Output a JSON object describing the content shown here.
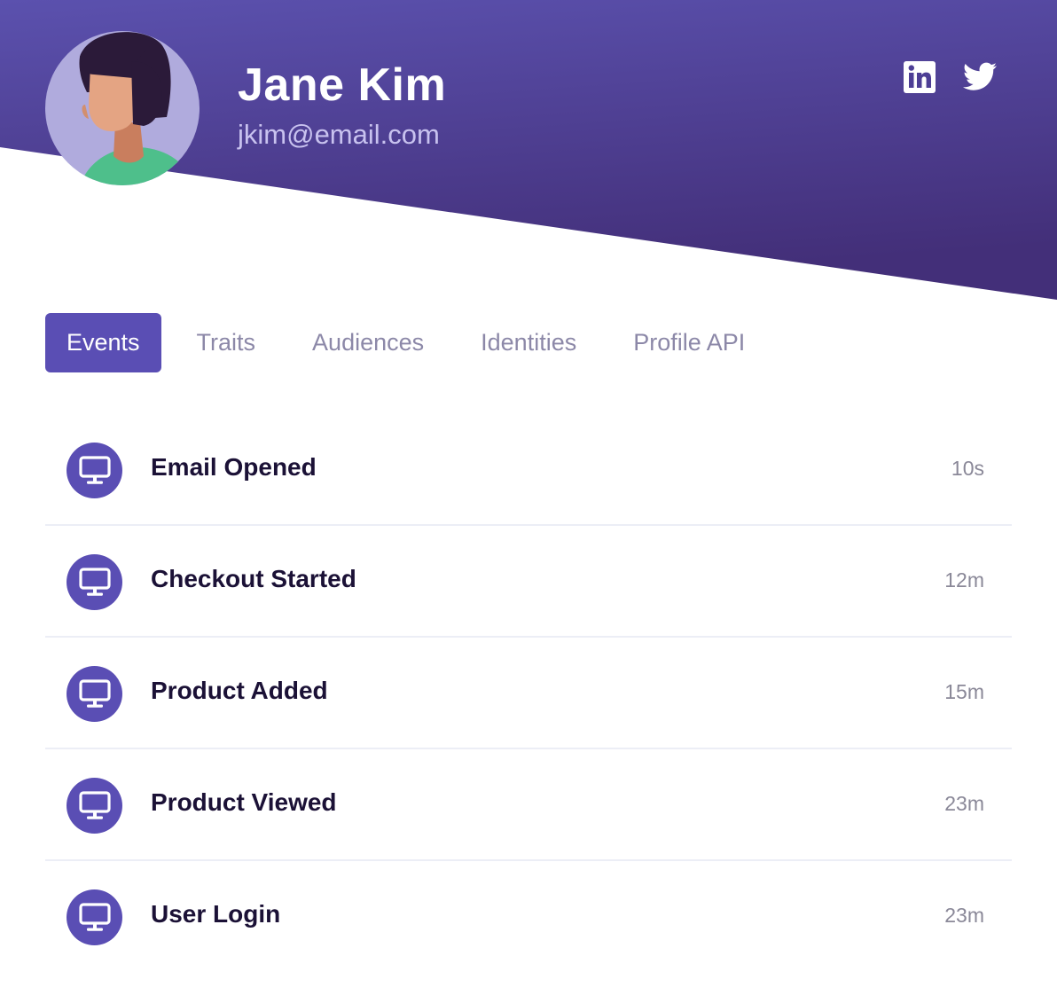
{
  "profile": {
    "name": "Jane Kim",
    "email": "jkim@email.com",
    "avatar_icon": "user-avatar-illustration",
    "social": [
      {
        "icon": "linkedin-icon"
      },
      {
        "icon": "twitter-icon"
      }
    ]
  },
  "tabs": [
    {
      "label": "Events",
      "active": true
    },
    {
      "label": "Traits",
      "active": false
    },
    {
      "label": "Audiences",
      "active": false
    },
    {
      "label": "Identities",
      "active": false
    },
    {
      "label": "Profile API",
      "active": false
    }
  ],
  "events": [
    {
      "name": "Email Opened",
      "time": "10s",
      "icon": "monitor-icon"
    },
    {
      "name": "Checkout Started",
      "time": "12m",
      "icon": "monitor-icon"
    },
    {
      "name": "Product Added",
      "time": "15m",
      "icon": "monitor-icon"
    },
    {
      "name": "Product Viewed",
      "time": "23m",
      "icon": "monitor-icon"
    },
    {
      "name": "User Login",
      "time": "23m",
      "icon": "monitor-icon"
    }
  ],
  "colors": {
    "accent": "#5a4eb4",
    "header_top": "#5a4fac",
    "header_bottom": "#42307a",
    "text_dark": "#1b1136",
    "text_muted": "#8c88a8"
  }
}
